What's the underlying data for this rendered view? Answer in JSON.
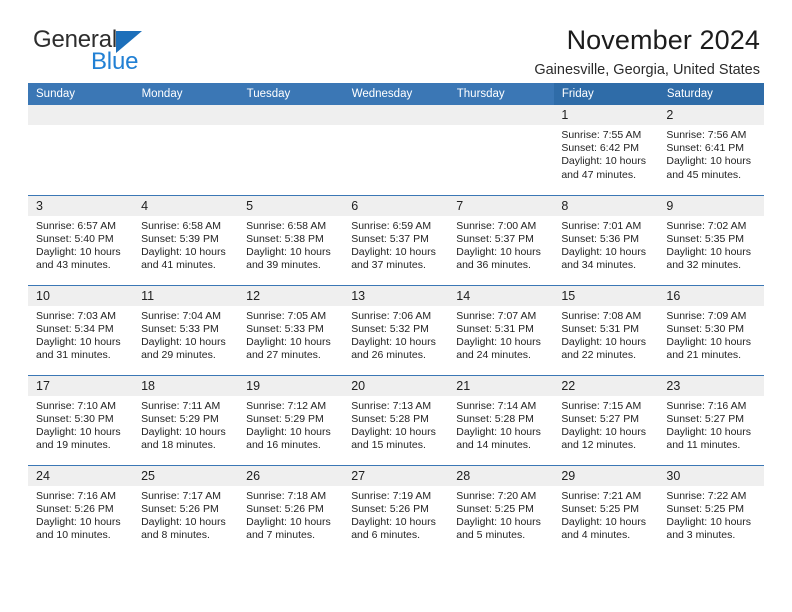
{
  "brand": {
    "name_part1": "General",
    "name_part2": "Blue",
    "accent_color": "#1c6fba",
    "blue_text_color": "#2180d4"
  },
  "header": {
    "title": "November 2024",
    "subtitle": "Gainesville, Georgia, United States"
  },
  "theme": {
    "header_blue": "#3b77b5",
    "weekend_header_blue": "#2f6ca8",
    "daynum_background": "#efefef"
  },
  "calendar": {
    "columns": [
      {
        "label": "Sunday",
        "weekend": false
      },
      {
        "label": "Monday",
        "weekend": false
      },
      {
        "label": "Tuesday",
        "weekend": false
      },
      {
        "label": "Wednesday",
        "weekend": false
      },
      {
        "label": "Thursday",
        "weekend": false
      },
      {
        "label": "Friday",
        "weekend": true
      },
      {
        "label": "Saturday",
        "weekend": true
      }
    ],
    "weeks": [
      [
        {
          "day": "",
          "lines": []
        },
        {
          "day": "",
          "lines": []
        },
        {
          "day": "",
          "lines": []
        },
        {
          "day": "",
          "lines": []
        },
        {
          "day": "",
          "lines": []
        },
        {
          "day": "1",
          "lines": [
            "Sunrise: 7:55 AM",
            "Sunset: 6:42 PM",
            "Daylight: 10 hours and 47 minutes."
          ]
        },
        {
          "day": "2",
          "lines": [
            "Sunrise: 7:56 AM",
            "Sunset: 6:41 PM",
            "Daylight: 10 hours and 45 minutes."
          ]
        }
      ],
      [
        {
          "day": "3",
          "lines": [
            "Sunrise: 6:57 AM",
            "Sunset: 5:40 PM",
            "Daylight: 10 hours and 43 minutes."
          ]
        },
        {
          "day": "4",
          "lines": [
            "Sunrise: 6:58 AM",
            "Sunset: 5:39 PM",
            "Daylight: 10 hours and 41 minutes."
          ]
        },
        {
          "day": "5",
          "lines": [
            "Sunrise: 6:58 AM",
            "Sunset: 5:38 PM",
            "Daylight: 10 hours and 39 minutes."
          ]
        },
        {
          "day": "6",
          "lines": [
            "Sunrise: 6:59 AM",
            "Sunset: 5:37 PM",
            "Daylight: 10 hours and 37 minutes."
          ]
        },
        {
          "day": "7",
          "lines": [
            "Sunrise: 7:00 AM",
            "Sunset: 5:37 PM",
            "Daylight: 10 hours and 36 minutes."
          ]
        },
        {
          "day": "8",
          "lines": [
            "Sunrise: 7:01 AM",
            "Sunset: 5:36 PM",
            "Daylight: 10 hours and 34 minutes."
          ]
        },
        {
          "day": "9",
          "lines": [
            "Sunrise: 7:02 AM",
            "Sunset: 5:35 PM",
            "Daylight: 10 hours and 32 minutes."
          ]
        }
      ],
      [
        {
          "day": "10",
          "lines": [
            "Sunrise: 7:03 AM",
            "Sunset: 5:34 PM",
            "Daylight: 10 hours and 31 minutes."
          ]
        },
        {
          "day": "11",
          "lines": [
            "Sunrise: 7:04 AM",
            "Sunset: 5:33 PM",
            "Daylight: 10 hours and 29 minutes."
          ]
        },
        {
          "day": "12",
          "lines": [
            "Sunrise: 7:05 AM",
            "Sunset: 5:33 PM",
            "Daylight: 10 hours and 27 minutes."
          ]
        },
        {
          "day": "13",
          "lines": [
            "Sunrise: 7:06 AM",
            "Sunset: 5:32 PM",
            "Daylight: 10 hours and 26 minutes."
          ]
        },
        {
          "day": "14",
          "lines": [
            "Sunrise: 7:07 AM",
            "Sunset: 5:31 PM",
            "Daylight: 10 hours and 24 minutes."
          ]
        },
        {
          "day": "15",
          "lines": [
            "Sunrise: 7:08 AM",
            "Sunset: 5:31 PM",
            "Daylight: 10 hours and 22 minutes."
          ]
        },
        {
          "day": "16",
          "lines": [
            "Sunrise: 7:09 AM",
            "Sunset: 5:30 PM",
            "Daylight: 10 hours and 21 minutes."
          ]
        }
      ],
      [
        {
          "day": "17",
          "lines": [
            "Sunrise: 7:10 AM",
            "Sunset: 5:30 PM",
            "Daylight: 10 hours and 19 minutes."
          ]
        },
        {
          "day": "18",
          "lines": [
            "Sunrise: 7:11 AM",
            "Sunset: 5:29 PM",
            "Daylight: 10 hours and 18 minutes."
          ]
        },
        {
          "day": "19",
          "lines": [
            "Sunrise: 7:12 AM",
            "Sunset: 5:29 PM",
            "Daylight: 10 hours and 16 minutes."
          ]
        },
        {
          "day": "20",
          "lines": [
            "Sunrise: 7:13 AM",
            "Sunset: 5:28 PM",
            "Daylight: 10 hours and 15 minutes."
          ]
        },
        {
          "day": "21",
          "lines": [
            "Sunrise: 7:14 AM",
            "Sunset: 5:28 PM",
            "Daylight: 10 hours and 14 minutes."
          ]
        },
        {
          "day": "22",
          "lines": [
            "Sunrise: 7:15 AM",
            "Sunset: 5:27 PM",
            "Daylight: 10 hours and 12 minutes."
          ]
        },
        {
          "day": "23",
          "lines": [
            "Sunrise: 7:16 AM",
            "Sunset: 5:27 PM",
            "Daylight: 10 hours and 11 minutes."
          ]
        }
      ],
      [
        {
          "day": "24",
          "lines": [
            "Sunrise: 7:16 AM",
            "Sunset: 5:26 PM",
            "Daylight: 10 hours and 10 minutes."
          ]
        },
        {
          "day": "25",
          "lines": [
            "Sunrise: 7:17 AM",
            "Sunset: 5:26 PM",
            "Daylight: 10 hours and 8 minutes."
          ]
        },
        {
          "day": "26",
          "lines": [
            "Sunrise: 7:18 AM",
            "Sunset: 5:26 PM",
            "Daylight: 10 hours and 7 minutes."
          ]
        },
        {
          "day": "27",
          "lines": [
            "Sunrise: 7:19 AM",
            "Sunset: 5:26 PM",
            "Daylight: 10 hours and 6 minutes."
          ]
        },
        {
          "day": "28",
          "lines": [
            "Sunrise: 7:20 AM",
            "Sunset: 5:25 PM",
            "Daylight: 10 hours and 5 minutes."
          ]
        },
        {
          "day": "29",
          "lines": [
            "Sunrise: 7:21 AM",
            "Sunset: 5:25 PM",
            "Daylight: 10 hours and 4 minutes."
          ]
        },
        {
          "day": "30",
          "lines": [
            "Sunrise: 7:22 AM",
            "Sunset: 5:25 PM",
            "Daylight: 10 hours and 3 minutes."
          ]
        }
      ]
    ]
  }
}
